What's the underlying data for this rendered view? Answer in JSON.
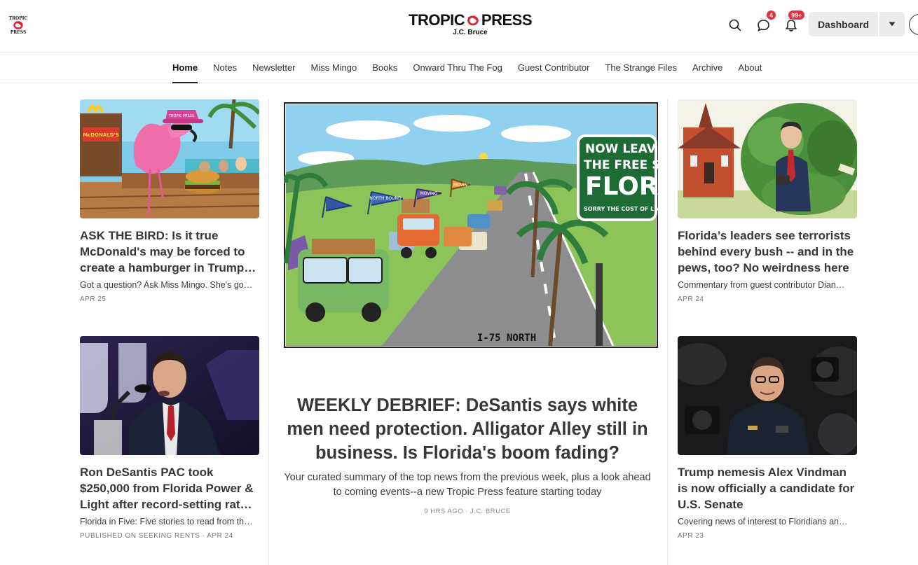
{
  "header": {
    "brand_word_left": "TROPIC",
    "brand_word_right": "PRESS",
    "brand_byline": "J.C. Bruce",
    "chat_badge": "4",
    "bell_badge": "99+",
    "dashboard_label": "Dashboard",
    "accent": "#e0303a"
  },
  "nav": {
    "items": [
      "Home",
      "Notes",
      "Newsletter",
      "Miss Mingo",
      "Books",
      "Onward Thru The Fog",
      "Guest Contributor",
      "The Strange Files",
      "Archive",
      "About"
    ],
    "active": "Home"
  },
  "cards": {
    "bird": {
      "title": "ASK THE BIRD: Is it true McDonald's may be forced to create a hamburger in Trump…",
      "subtitle": "Got a question? Ask Miss Mingo. She's go…",
      "meta": "APR 25",
      "image_sign_1": "McDONALD'S",
      "image_sign_2": "TROPIC PRESS"
    },
    "desantis": {
      "title": "Ron DeSantis PAC took $250,000 from Florida Power & Light after record-setting rat…",
      "subtitle": "Florida in Five: Five stories to read from th…",
      "meta": "PUBLISHED ON SEEKING RENTS · APR 24"
    },
    "terrorists": {
      "title": "Florida’s leaders see terrorists behind every bush -- and in the pews, too? No weirdness here",
      "subtitle": "Commentary from guest contributor Dian…",
      "meta": "APR 24"
    },
    "vindman": {
      "title": "Trump nemesis Alex Vindman is now officially a candidate for U.S. Senate",
      "subtitle": "Covering news of interest to Floridians an…",
      "meta": "APR 23"
    }
  },
  "feature": {
    "title": "WEEKLY DEBRIEF: DeSantis says white men need protection. Alligator Alley still in business. Is Florida's boom fading?",
    "subtitle": "Your curated summary of the top news from the previous week, plus a look ahead to coming events--a new Tropic Press feature starting today",
    "meta": "9 HRS AGO · J.C. BRUCE",
    "sign_line1": "NOW LEAV",
    "sign_line2": "THE FREE ST",
    "sign_line3": "FLOR",
    "sign_line4": "SORRY THE COST OF LIVING IS",
    "road_label": "I-75 NORTH",
    "flag_1": "NORTH BOUND",
    "flag_2": "MOVING",
    "flag_3": "MOVIN"
  }
}
